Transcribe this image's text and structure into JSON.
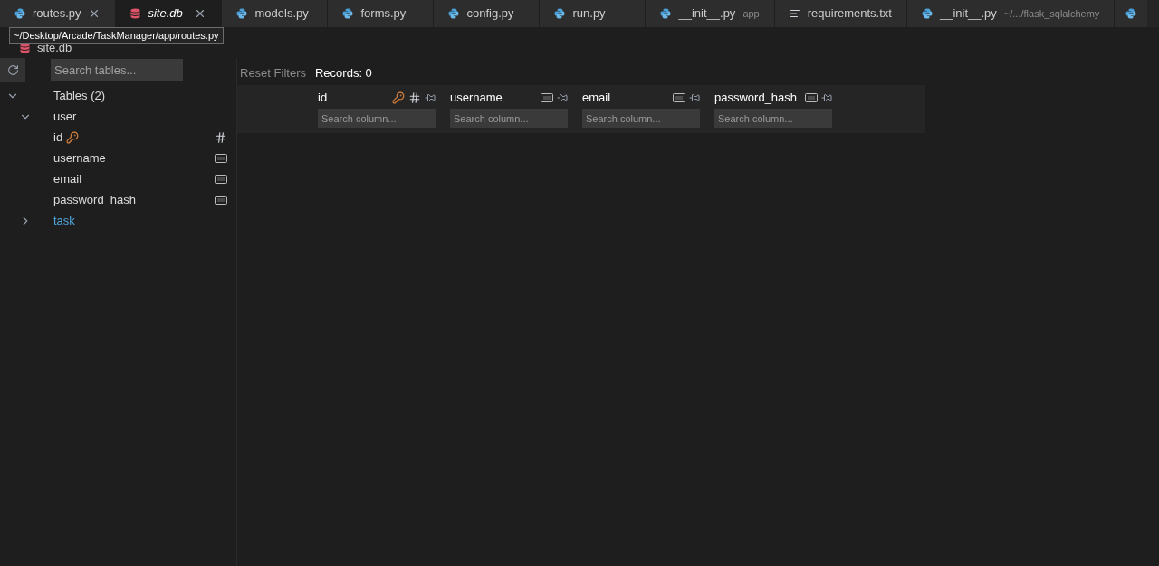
{
  "tabs": [
    {
      "label": "routes.py",
      "kind": "python",
      "selected": false,
      "closable": true
    },
    {
      "label": "site.db",
      "kind": "database",
      "selected": true,
      "closable": true
    },
    {
      "label": "models.py",
      "kind": "python",
      "selected": false,
      "closable": false
    },
    {
      "label": "forms.py",
      "kind": "python",
      "selected": false,
      "closable": false
    },
    {
      "label": "config.py",
      "kind": "python",
      "selected": false,
      "closable": false
    },
    {
      "label": "run.py",
      "kind": "python",
      "selected": false,
      "closable": false
    },
    {
      "label": "__init__.py",
      "detail": "app",
      "kind": "python",
      "selected": false,
      "closable": false
    },
    {
      "label": "requirements.txt",
      "kind": "text",
      "selected": false,
      "closable": false
    },
    {
      "label": "__init__.py",
      "detail": "~/.../flask_sqlalchemy",
      "kind": "python",
      "selected": false,
      "closable": false
    }
  ],
  "tooltip": "~/Desktop/Arcade/TaskManager/app/routes.py",
  "breadcrumb": "site.db",
  "sidebar": {
    "search_placeholder": "Search tables...",
    "tree": {
      "label": "Tables (2)",
      "expanded": true,
      "children": [
        {
          "label": "user",
          "expanded": true,
          "children": [
            {
              "label": "id",
              "primary_key": true,
              "kind": "integer"
            },
            {
              "label": "username",
              "primary_key": false,
              "kind": "text"
            },
            {
              "label": "email",
              "primary_key": false,
              "kind": "text"
            },
            {
              "label": "password_hash",
              "primary_key": false,
              "kind": "text"
            }
          ]
        },
        {
          "label": "task",
          "expanded": false
        }
      ]
    }
  },
  "toolbar": {
    "reset": "Reset Filters",
    "records": "Records: 0"
  },
  "columns": [
    {
      "name": "id",
      "primary_key": true,
      "kind": "integer",
      "placeholder": "Search column..."
    },
    {
      "name": "username",
      "primary_key": false,
      "kind": "text",
      "placeholder": "Search column..."
    },
    {
      "name": "email",
      "primary_key": false,
      "kind": "text",
      "placeholder": "Search column..."
    },
    {
      "name": "password_hash",
      "primary_key": false,
      "kind": "text",
      "placeholder": "Search column..."
    }
  ]
}
